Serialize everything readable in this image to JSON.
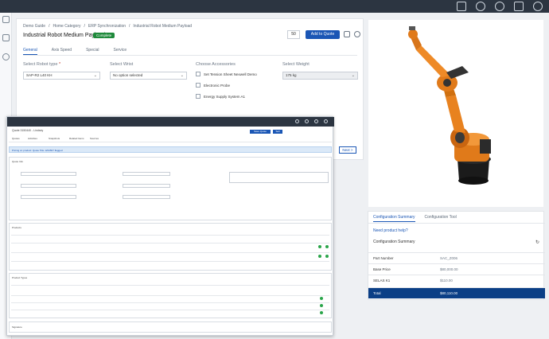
{
  "top": {
    "icons": [
      "cart-icon",
      "clock-icon",
      "star-icon",
      "inbox-icon",
      "account-icon"
    ]
  },
  "breadcrumb": [
    "Demo Guide",
    "/",
    "Home Category",
    "/",
    "ERP Synchronization",
    "/",
    "Industrial Robot Medium Payload"
  ],
  "product": {
    "title": "Industrial Robot Medium Payload",
    "status": "Complete",
    "quantity": "50",
    "add_to_quote": "Add to Quote"
  },
  "tabs": [
    "General",
    "Axis Speed",
    "Special",
    "Service"
  ],
  "form": {
    "robot_type_label": "Select Robot type",
    "required": "*",
    "robot_type_value": "SAP-R2 L40 KH",
    "wrist_label": "Select Wrist",
    "wrist_value": "No option selected",
    "accessories_label": "Choose Accessories",
    "accessories": [
      "Set Tension Sheet Nexwell Demo",
      "Electronic Probe",
      "Energy Supply System A1"
    ],
    "weight_label": "Select Weight",
    "weight_value": "175 kg",
    "next": "Next >"
  },
  "summary": {
    "tabs": [
      "Configuration Summary",
      "Configuration Tool"
    ],
    "help": "Need product help?",
    "heading": "Configuration Summary",
    "rows": [
      {
        "label": "Part Number",
        "value": "SAC_Z006"
      },
      {
        "label": "Base Price",
        "value": "$80,000.00"
      },
      {
        "label": "SELAS K1",
        "value": "$110.00"
      },
      {
        "label": "Total",
        "value": "$80,110.00"
      }
    ]
  },
  "overlay": {
    "title": "Quote 3150440 - Lindsey",
    "tabs": [
      "Quotes",
      "Activities",
      "Snapshots",
      "Related Items",
      "Sources"
    ],
    "buttons": [
      "Save Quote",
      "Sell"
    ],
    "info": "Pricing on product: Quote Title 1234567 flagged",
    "sections": [
      "Quote Info",
      "Products",
      "Product Types",
      "Signature"
    ]
  }
}
